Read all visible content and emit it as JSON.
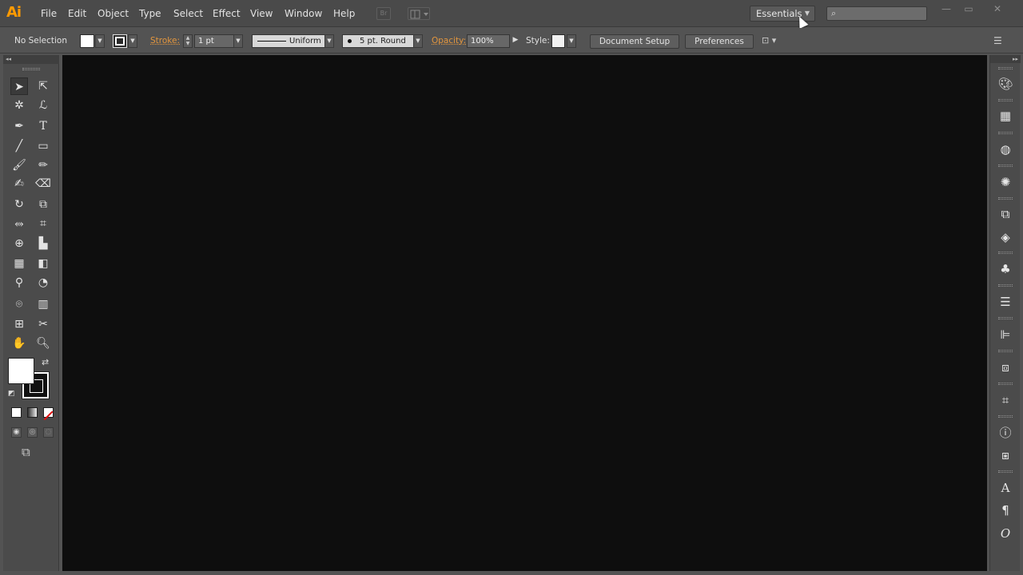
{
  "app": {
    "logo": "Ai",
    "accent_color": "#ff9a00"
  },
  "menubar": {
    "items": [
      "File",
      "Edit",
      "Object",
      "Type",
      "Select",
      "Effect",
      "View",
      "Window",
      "Help"
    ],
    "bridge_icon": "Br",
    "workspace": "Essentials",
    "search_placeholder": "",
    "window_controls": [
      "minimize-icon",
      "maximize-icon",
      "close-icon"
    ]
  },
  "controlbar": {
    "selection": "No Selection",
    "stroke_label": "Stroke:",
    "stroke_weight": "1 pt",
    "stroke_profile": "Uniform",
    "brush": "5 pt. Round",
    "opacity_label": "Opacity:",
    "opacity_value": "100%",
    "style_label": "Style:",
    "document_setup": "Document Setup",
    "preferences": "Preferences"
  },
  "tools": {
    "icons": [
      "selection-tool-icon",
      "direct-selection-tool-icon",
      "magic-wand-tool-icon",
      "lasso-tool-icon",
      "pen-tool-icon",
      "type-tool-icon",
      "line-segment-tool-icon",
      "rectangle-tool-icon",
      "paintbrush-tool-icon",
      "pencil-tool-icon",
      "blob-brush-tool-icon",
      "eraser-tool-icon",
      "rotate-tool-icon",
      "scale-tool-icon",
      "width-tool-icon",
      "free-transform-tool-icon",
      "shape-builder-tool-icon",
      "perspective-grid-tool-icon",
      "mesh-tool-icon",
      "gradient-tool-icon",
      "eyedropper-tool-icon",
      "blend-tool-icon",
      "symbol-sprayer-tool-icon",
      "column-graph-tool-icon",
      "artboard-tool-icon",
      "slice-tool-icon",
      "hand-tool-icon",
      "zoom-tool-icon"
    ],
    "fill_color": "#ffffff",
    "stroke_color": "#000000"
  },
  "dock": {
    "icons": [
      "color-panel-icon",
      "swatches-panel-icon",
      "symbols-panel-icon",
      "appearance-panel-icon",
      "transparency-panel-icon",
      "layers-panel-icon",
      "graphic-styles-panel-icon",
      "stroke-panel-icon",
      "align-panel-icon",
      "pathfinder-panel-icon",
      "transform-panel-icon",
      "document-info-panel-icon",
      "image-trace-panel-icon",
      "character-panel-icon",
      "paragraph-panel-icon",
      "opentype-panel-icon"
    ]
  }
}
